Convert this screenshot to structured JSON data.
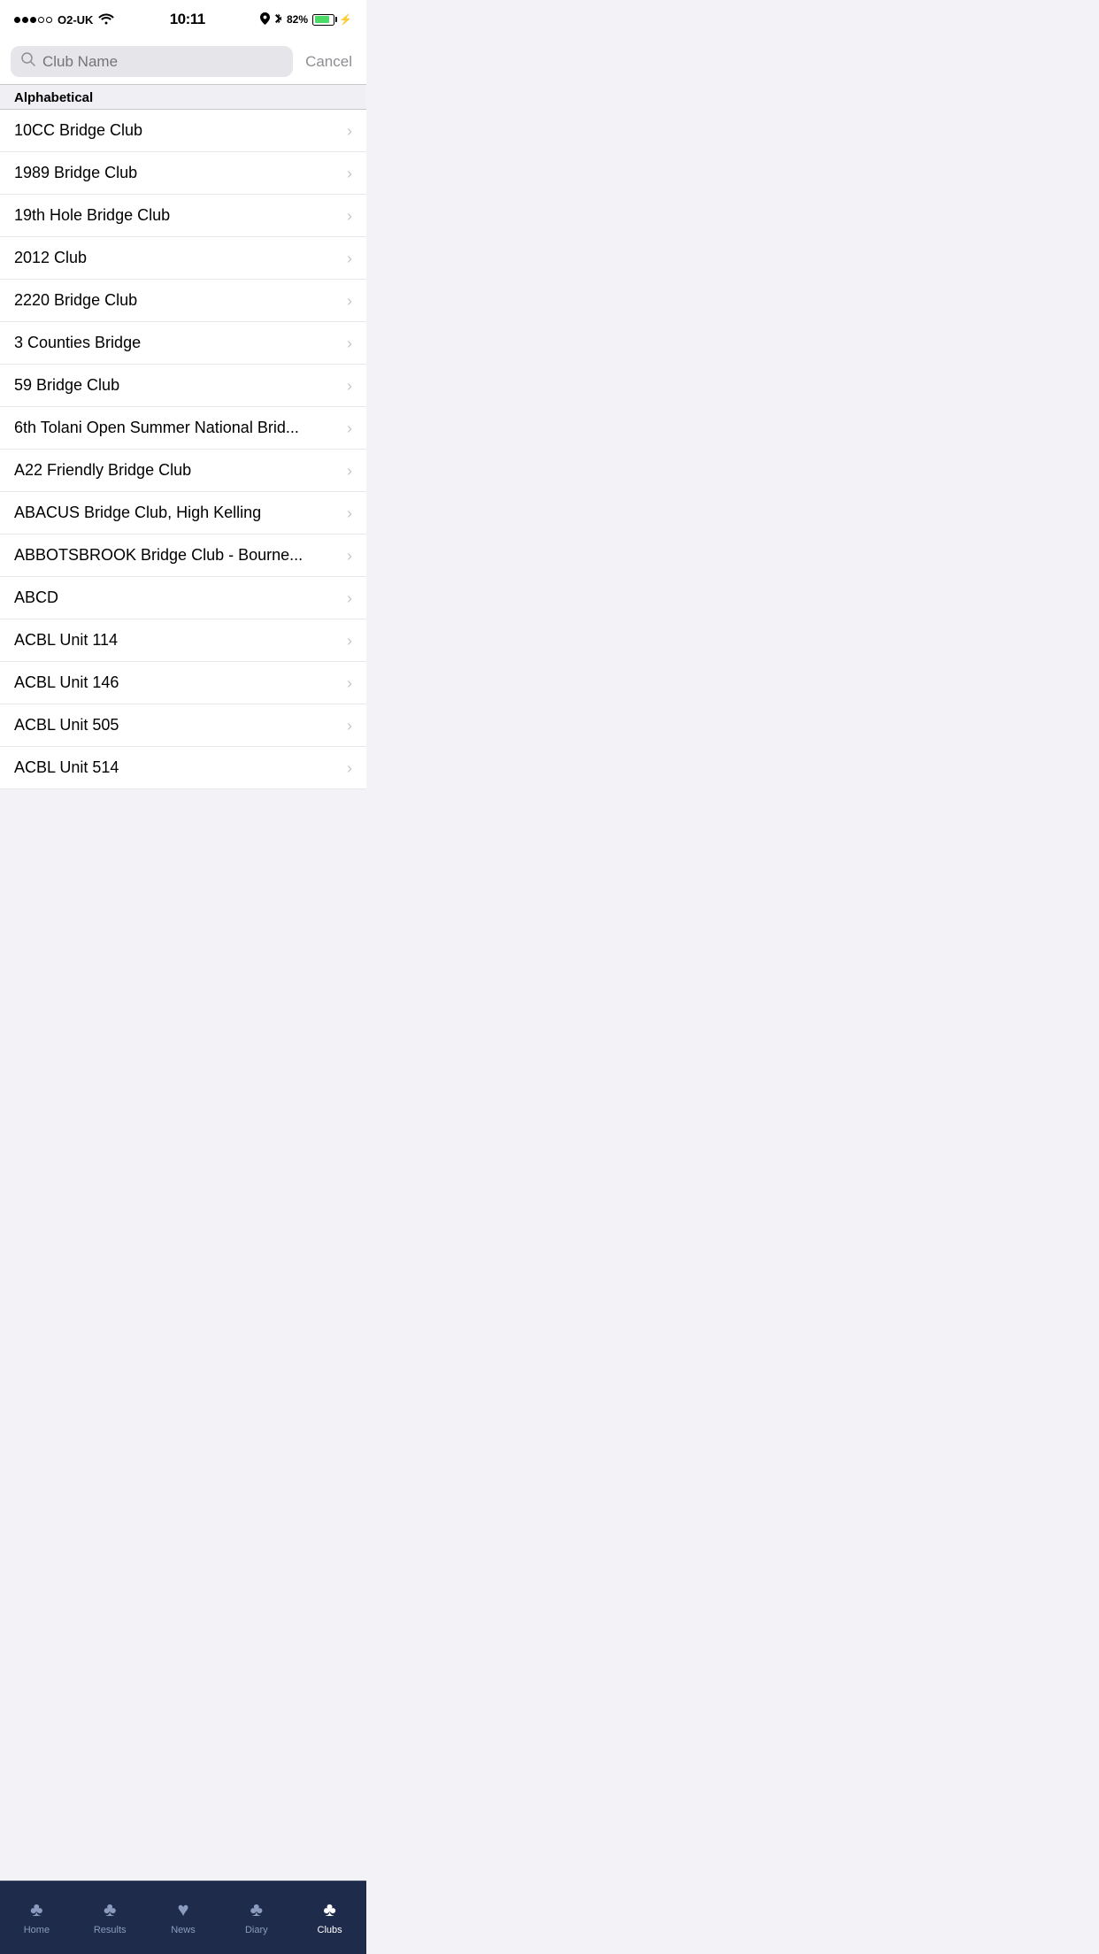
{
  "statusBar": {
    "carrier": "O2-UK",
    "time": "10:11",
    "battery": "82%"
  },
  "searchBar": {
    "placeholder": "Club Name",
    "cancelLabel": "Cancel"
  },
  "sectionHeader": {
    "label": "Alphabetical"
  },
  "clubs": [
    {
      "name": "10CC Bridge Club"
    },
    {
      "name": "1989 Bridge Club"
    },
    {
      "name": "19th Hole Bridge Club"
    },
    {
      "name": "2012 Club"
    },
    {
      "name": "2220 Bridge Club"
    },
    {
      "name": "3 Counties Bridge"
    },
    {
      "name": "59 Bridge Club"
    },
    {
      "name": "6th Tolani Open Summer National Brid..."
    },
    {
      "name": "A22 Friendly Bridge Club"
    },
    {
      "name": "ABACUS Bridge Club, High Kelling"
    },
    {
      "name": "ABBOTSBROOK Bridge Club - Bourne..."
    },
    {
      "name": "ABCD"
    },
    {
      "name": "ACBL Unit 114"
    },
    {
      "name": "ACBL Unit 146"
    },
    {
      "name": "ACBL Unit 505"
    },
    {
      "name": "ACBL Unit 514"
    }
  ],
  "tabBar": {
    "items": [
      {
        "id": "home",
        "label": "Home",
        "icon": "♣",
        "active": false
      },
      {
        "id": "results",
        "label": "Results",
        "icon": "♣",
        "active": false
      },
      {
        "id": "news",
        "label": "News",
        "icon": "♥",
        "active": false
      },
      {
        "id": "diary",
        "label": "Diary",
        "icon": "♣",
        "active": false
      },
      {
        "id": "clubs",
        "label": "Clubs",
        "icon": "♣",
        "active": true
      }
    ]
  }
}
